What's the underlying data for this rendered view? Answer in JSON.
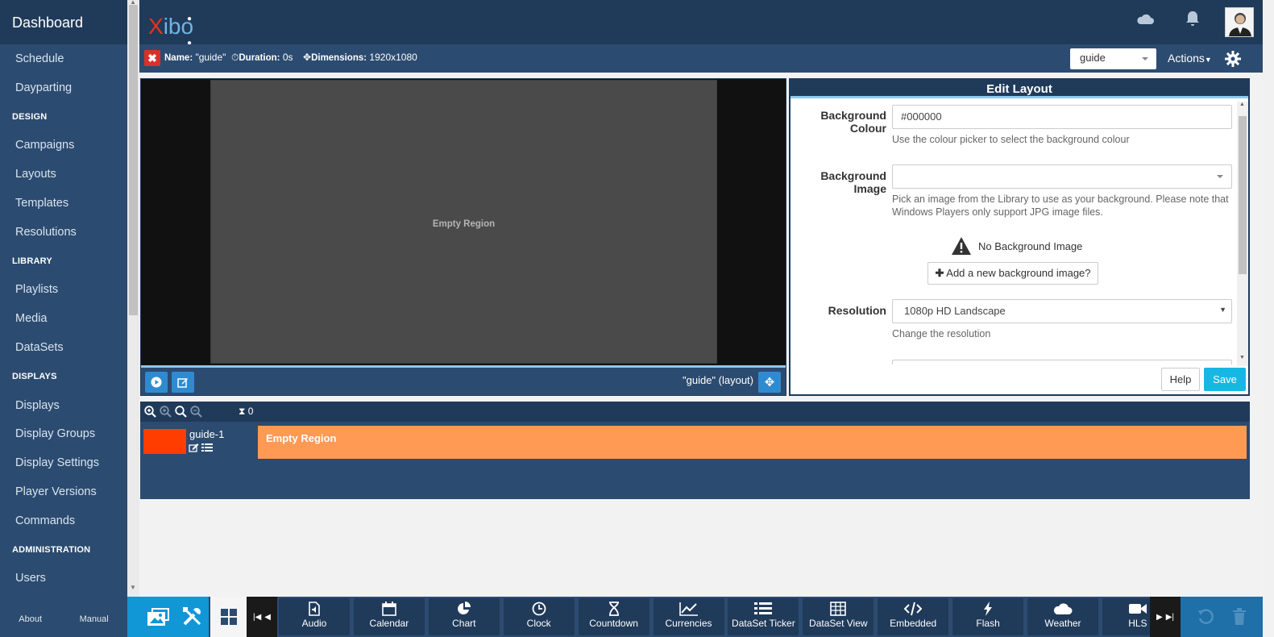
{
  "sidebar": {
    "brand": "Dashboard",
    "items": [
      {
        "type": "item",
        "label": "Schedule"
      },
      {
        "type": "item",
        "label": "Dayparting"
      },
      {
        "type": "head",
        "label": "DESIGN"
      },
      {
        "type": "item",
        "label": "Campaigns"
      },
      {
        "type": "item",
        "label": "Layouts"
      },
      {
        "type": "item",
        "label": "Templates"
      },
      {
        "type": "item",
        "label": "Resolutions"
      },
      {
        "type": "head",
        "label": "LIBRARY"
      },
      {
        "type": "item",
        "label": "Playlists"
      },
      {
        "type": "item",
        "label": "Media"
      },
      {
        "type": "item",
        "label": "DataSets"
      },
      {
        "type": "head",
        "label": "DISPLAYS"
      },
      {
        "type": "item",
        "label": "Displays"
      },
      {
        "type": "item",
        "label": "Display Groups"
      },
      {
        "type": "item",
        "label": "Display Settings"
      },
      {
        "type": "item",
        "label": "Player Versions"
      },
      {
        "type": "item",
        "label": "Commands"
      },
      {
        "type": "head",
        "label": "ADMINISTRATION"
      },
      {
        "type": "item",
        "label": "Users"
      }
    ],
    "footer": {
      "about": "About",
      "manual": "Manual"
    }
  },
  "header": {
    "logo_x": "X",
    "logo_rest": "ibo",
    "cloud_icon": "cloud-icon",
    "bell_icon": "bell-icon"
  },
  "layout_bar": {
    "name_label": "Name:",
    "name_value": "\"guide\"",
    "duration_label": "Duration:",
    "duration_value": "0s",
    "dimensions_label": "Dimensions:",
    "dimensions_value": "1920x1080",
    "selected_layout": "guide",
    "actions_label": "Actions"
  },
  "viewer": {
    "region_text": "Empty Region",
    "layout_name": "\"guide\" (layout)"
  },
  "edit_panel": {
    "title": "Edit Layout",
    "bg_colour_label_1": "Background",
    "bg_colour_label_2": "Colour",
    "bg_colour_value": "#000000",
    "bg_colour_help": "Use the colour picker to select the background colour",
    "bg_image_label": "Background Image",
    "bg_image_value": "",
    "bg_image_help_1": "Pick an image from the Library to use as your background. Please note that",
    "bg_image_help_2": "Windows Players only support JPG image files.",
    "no_bg_text": "No Background Image",
    "add_bg_label": "Add a new background image?",
    "resolution_label": "Resolution",
    "resolution_value": "1080p HD Landscape",
    "resolution_help": "Change the resolution",
    "help_button": "Help",
    "save_button": "Save"
  },
  "timeline": {
    "count": "0",
    "region_name": "guide-1",
    "region_bar_text": "Empty Region"
  },
  "toolbox": {
    "items": [
      "Audio",
      "Calendar",
      "Chart",
      "Clock",
      "Countdown",
      "Currencies",
      "DataSet Ticker",
      "DataSet View",
      "Embedded",
      "Flash",
      "Weather",
      "HLS"
    ]
  },
  "colors": {
    "sidebar": "#2c4b70",
    "header": "#203a5a",
    "accent": "#2f8bd0",
    "save": "#17b7e3",
    "region": "#ff9a55",
    "danger": "#d9302c"
  }
}
